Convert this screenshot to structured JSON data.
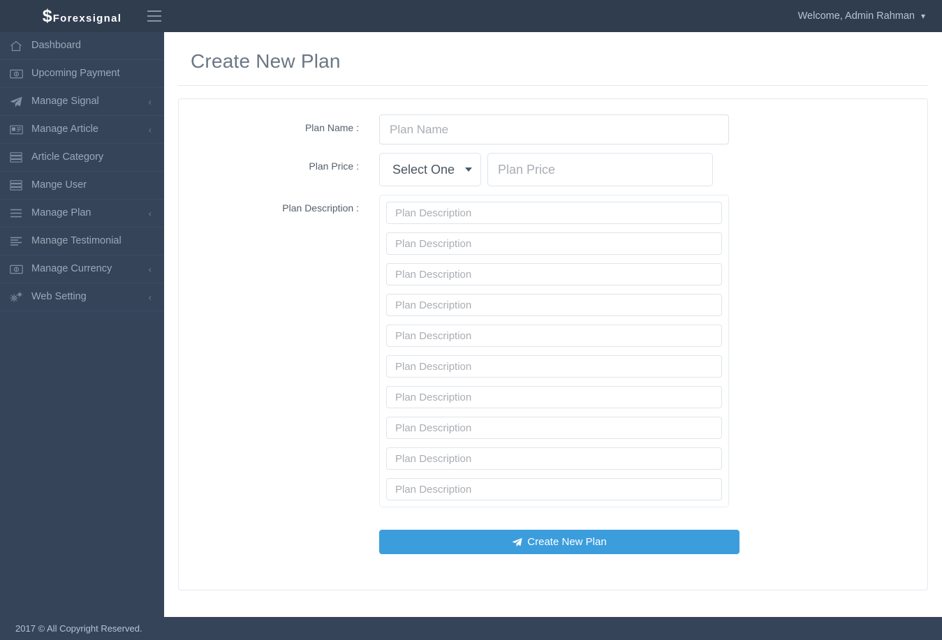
{
  "brand": {
    "symbol": "$",
    "name": "Forexsignal",
    "menu_toggle_icon": "hamburger-icon"
  },
  "topbar": {
    "welcome": "Welcome, Admin Rahman",
    "caret_icon": "chevron-down-icon"
  },
  "sidebar": {
    "items": [
      {
        "label": "Dashboard",
        "icon": "home-icon",
        "arrow": ""
      },
      {
        "label": "Upcoming Payment",
        "icon": "money-bill-icon",
        "arrow": ""
      },
      {
        "label": "Manage Signal",
        "icon": "paper-plane-icon",
        "arrow": "‹"
      },
      {
        "label": "Manage Article",
        "icon": "id-card-icon",
        "arrow": "‹"
      },
      {
        "label": "Article Category",
        "icon": "server-icon",
        "arrow": ""
      },
      {
        "label": "Mange User",
        "icon": "server-icon",
        "arrow": ""
      },
      {
        "label": "Manage Plan",
        "icon": "bars-icon",
        "arrow": "‹"
      },
      {
        "label": "Manage Testimonial",
        "icon": "align-left-icon",
        "arrow": ""
      },
      {
        "label": "Manage Currency",
        "icon": "money-bill-icon",
        "arrow": "‹"
      },
      {
        "label": "Web Setting",
        "icon": "cogs-icon",
        "arrow": "‹"
      }
    ]
  },
  "page": {
    "title": "Create New Plan"
  },
  "form": {
    "plan_name": {
      "label": "Plan Name :",
      "placeholder": "Plan Name",
      "value": ""
    },
    "plan_price": {
      "label": "Plan Price :",
      "select_selected": "Select One",
      "select_options": [
        "Select One"
      ],
      "price_placeholder": "Plan Price",
      "price_value": "",
      "caret_icon": "caret-down-icon"
    },
    "plan_description": {
      "label": "Plan Description :",
      "placeholder": "Plan Description",
      "rows": [
        {
          "value": ""
        },
        {
          "value": ""
        },
        {
          "value": ""
        },
        {
          "value": ""
        },
        {
          "value": ""
        },
        {
          "value": ""
        },
        {
          "value": ""
        },
        {
          "value": ""
        },
        {
          "value": ""
        },
        {
          "value": ""
        }
      ]
    },
    "submit": {
      "label": "Create New Plan",
      "icon": "paper-plane-icon"
    }
  },
  "footer": {
    "copyright": "2017 © All Copyright Reserved."
  },
  "colors": {
    "topbar_bg": "#2f3d4f",
    "sidebar_bg": "#36445a",
    "primary": "#3c9ddd",
    "title_text": "#6b7785",
    "nav_text": "#9aa8b8"
  }
}
